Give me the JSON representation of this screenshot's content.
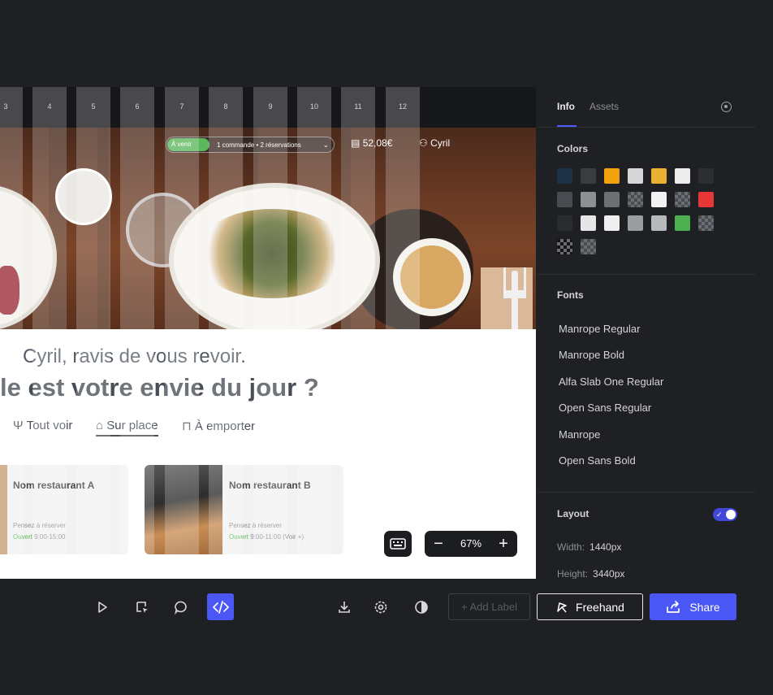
{
  "canvas": {
    "ruler_columns": [
      "3",
      "4",
      "5",
      "6",
      "7",
      "8",
      "9",
      "10",
      "11",
      "12"
    ],
    "hero": {
      "status_badge": "À venir",
      "orders_summary": "1 commande • 2 réservations",
      "amount": "52,08€",
      "user_name": "Cyril"
    },
    "greeting": "Cyril, ravis de vous revoir.",
    "question": "le est votre envie du jour ?",
    "filters": [
      {
        "icon": "utensils-icon",
        "label": "Tout voir"
      },
      {
        "icon": "storefront-icon",
        "label": "Sur place"
      },
      {
        "icon": "bag-icon",
        "label": "À emporter"
      }
    ],
    "restaurants": [
      {
        "name": "Nom restaurant A",
        "hint": "Pensez à réserver",
        "status": "Ouvert",
        "hours": "9:00-15:00"
      },
      {
        "name": "Nom restaurant B",
        "hint": "Pensez à réserver",
        "status": "Ouvert",
        "hours": "9:00-11:00 (Voir +)"
      }
    ],
    "zoom": {
      "minus": "−",
      "value": "67%",
      "plus": "+"
    }
  },
  "panel": {
    "tabs": [
      "Info",
      "Assets"
    ],
    "colors_title": "Colors",
    "colors": [
      "#1e3044",
      "#3b3c40",
      "#f2a20d",
      "#d6d6d6",
      "#e8b131",
      "#ececec",
      "#2d2e32",
      "#4a4b50",
      "#8e8f94",
      "#6e6f74",
      "checker",
      "#f2f2f2",
      "checker",
      "#e63636",
      "#2a2b2f",
      "#e6e6e6",
      "#eeeeee",
      "#9c9da1",
      "#b8b9bc",
      "#4caf50",
      "checker",
      "checker-dark",
      "checker"
    ],
    "fonts_title": "Fonts",
    "fonts": [
      "Manrope Regular",
      "Manrope Bold",
      "Alfa Slab One Regular",
      "Open Sans Regular",
      "Manrope",
      "Open Sans Bold"
    ],
    "layout_title": "Layout",
    "layout": {
      "width_label": "Width:",
      "width_value": "1440px",
      "height_label": "Height:",
      "height_value": "3440px",
      "enabled": true
    }
  },
  "toolbar": {
    "add_label": "+ Add Label",
    "freehand_label": "Freehand",
    "share_label": "Share",
    "accent": "#4b57f5"
  }
}
